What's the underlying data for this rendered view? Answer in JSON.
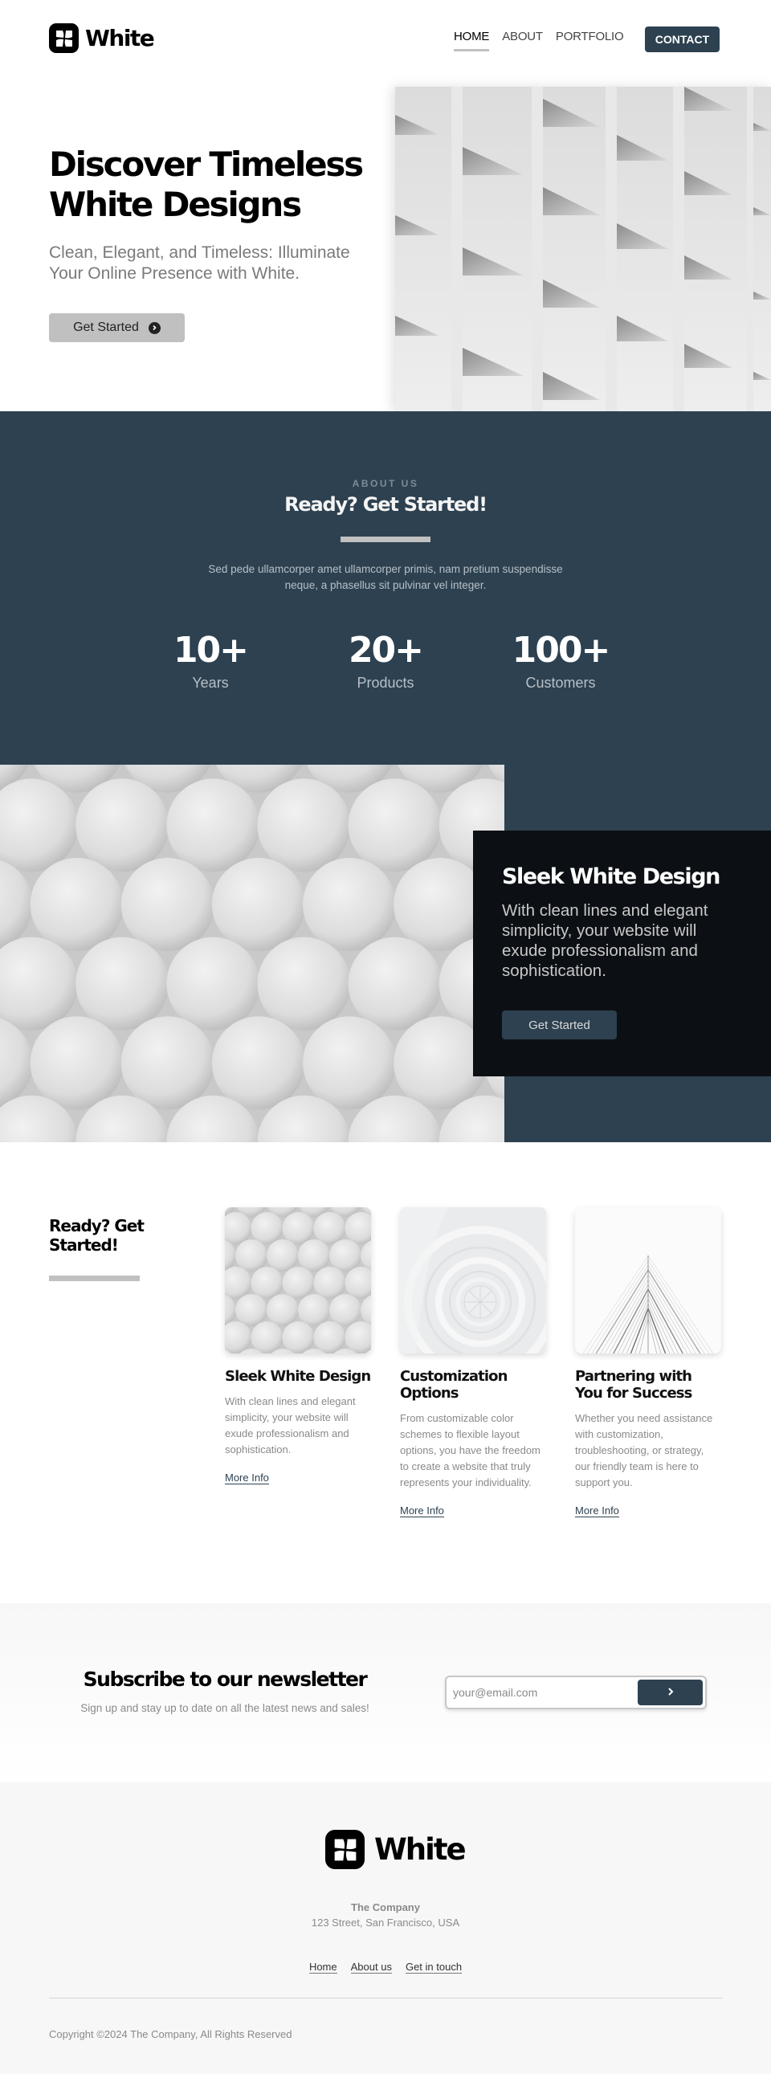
{
  "brand": {
    "name": "White"
  },
  "nav": {
    "items": [
      {
        "label": "HOME",
        "active": true
      },
      {
        "label": "ABOUT",
        "active": false
      },
      {
        "label": "PORTFOLIO",
        "active": false
      }
    ],
    "contact_label": "CONTACT"
  },
  "hero": {
    "title": "Discover Timeless White Designs",
    "subtitle": "Clean, Elegant, and Timeless: Illuminate Your Online Presence with White.",
    "cta_label": "Get Started",
    "image_alt": "White building facade with angled balconies"
  },
  "about": {
    "eyebrow": "ABOUT US",
    "title": "Ready? Get Started!",
    "text": "Sed pede ullamcorper amet ullamcorper primis, nam pretium suspendisse neque, a phasellus sit pulvinar vel integer.",
    "stats": [
      {
        "value": "10+",
        "label": "Years"
      },
      {
        "value": "20+",
        "label": "Products"
      },
      {
        "value": "100+",
        "label": "Customers"
      }
    ]
  },
  "feature": {
    "image_alt": "White spheres",
    "title": "Sleek White Design",
    "text": "With clean lines and elegant simplicity, your website will exude professionalism and sophistication.",
    "cta_label": "Get Started"
  },
  "services": {
    "title": "Ready? Get Started!",
    "cards": [
      {
        "title": "Sleek White Design",
        "text": "With clean lines and elegant simplicity, your website will exude professionalism and sophistication.",
        "link": "More Info",
        "image_alt": "White spheres"
      },
      {
        "title": "Customization Options",
        "text": "From customizable color schemes to flexible layout options, you have the freedom to create a website that truly represents your individuality.",
        "link": "More Info",
        "image_alt": "White spiral staircase"
      },
      {
        "title": "Partnering with You for Success",
        "text": "Whether you need assistance with customization, troubleshooting, or strategy, our friendly team is here to support you.",
        "link": "More Info",
        "image_alt": "White skyscraper corner"
      }
    ]
  },
  "newsletter": {
    "title": "Subscribe to our newsletter",
    "subtitle": "Sign up and stay up to date on all the latest news and sales!",
    "email_placeholder": "your@email.com",
    "email_value": ""
  },
  "footer": {
    "company": "The Company",
    "address": "123 Street, San Francisco, USA",
    "links": [
      "Home",
      "About us",
      "Get in touch"
    ],
    "copyright": "Copyright ©2024 The Company, All Rights Reserved"
  },
  "colors": {
    "accent": "#2d4150",
    "dark_card": "#0c1014",
    "muted_bar": "#c0c0c0",
    "footer_bg": "#f7f7f7"
  }
}
